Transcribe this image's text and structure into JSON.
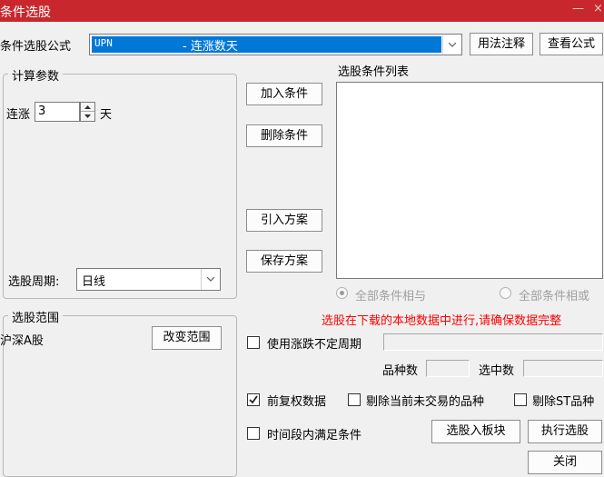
{
  "window": {
    "title": "条件选股",
    "minimize_glyph": "—",
    "close_glyph": "×"
  },
  "formula": {
    "label": "条件选股公式",
    "code": "UPN",
    "description": "- 连涨数天",
    "usage_button": "用法注释",
    "view_button": "查看公式"
  },
  "params": {
    "group_title": "计算参数",
    "rise_label": "连涨",
    "rise_value": "3",
    "rise_unit": "天",
    "period_label": "选股周期:",
    "period_value": "日线"
  },
  "actions": {
    "add_condition": "加入条件",
    "delete_condition": "删除条件",
    "import_plan": "引入方案",
    "save_plan": "保存方案"
  },
  "condition_list": {
    "title": "选股条件列表",
    "items": [],
    "and_label": "全部条件相与",
    "or_label": "全部条件相或",
    "and_selected": true
  },
  "warning_text": "选股在下载的本地数据中进行,请确保数据完整",
  "scope": {
    "group_title": "选股范围",
    "value": "沪深A股",
    "change_button": "改变范围"
  },
  "options": {
    "use_variable_period": {
      "label": "使用涨跌不定周期",
      "checked": false
    },
    "forward_adjusted": {
      "label": "前复权数据",
      "checked": true
    },
    "exclude_untraded": {
      "label": "剔除当前未交易的品种",
      "checked": false
    },
    "exclude_st": {
      "label": "剔除ST品种",
      "checked": false
    },
    "time_range": {
      "label": "时间段内满足条件",
      "checked": false
    }
  },
  "counts": {
    "varieties_label": "品种数",
    "varieties_value": "",
    "selected_label": "选中数",
    "selected_value": ""
  },
  "footer": {
    "to_block_button": "选股入板块",
    "execute_button": "执行选股",
    "close_button": "关闭"
  },
  "colors": {
    "titlebar": "#c8282d",
    "selection": "#0078d7",
    "warning": "#ff0000"
  },
  "icons": {
    "combo_arrow": "chevron-down-icon",
    "spin_up": "triangle-up-icon",
    "spin_down": "triangle-down-icon",
    "check": "check-icon"
  }
}
